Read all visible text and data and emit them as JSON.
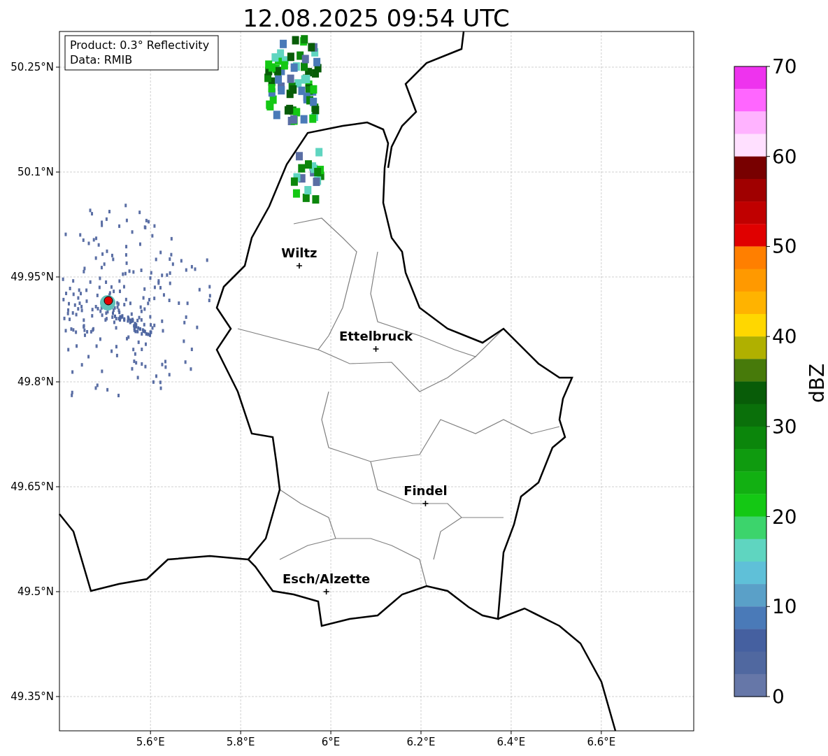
{
  "title": "12.08.2025 09:54 UTC",
  "info_box": [
    "Product: 0.3° Reflectivity",
    "Data: RMIB"
  ],
  "map": {
    "yticks": [
      "50.25°N",
      "50.1°N",
      "49.95°N",
      "49.8°N",
      "49.65°N",
      "49.5°N",
      "49.35°N"
    ],
    "xticks": [
      "5.6°E",
      "5.8°E",
      "6°E",
      "6.2°E",
      "6.4°E",
      "6.6°E"
    ],
    "cities": [
      {
        "name": "Wiltz"
      },
      {
        "name": "Ettelbruck"
      },
      {
        "name": "Findel"
      },
      {
        "name": "Esch/Alzette"
      }
    ]
  },
  "colorbar": {
    "label": "dBZ",
    "ticks": [
      "70",
      "60",
      "50",
      "40",
      "30",
      "20",
      "10",
      "0"
    ],
    "bins": [
      {
        "color": "#ee33ee"
      },
      {
        "color": "#ff66ff"
      },
      {
        "color": "#ffb3ff"
      },
      {
        "color": "#ffe0ff"
      },
      {
        "color": "#780000"
      },
      {
        "color": "#a00000"
      },
      {
        "color": "#c00000"
      },
      {
        "color": "#e00000"
      },
      {
        "color": "#ff7f00"
      },
      {
        "color": "#ff9900"
      },
      {
        "color": "#ffb300"
      },
      {
        "color": "#ffd700"
      },
      {
        "color": "#b0b000"
      },
      {
        "color": "#477a0a"
      },
      {
        "color": "#085c08"
      },
      {
        "color": "#0a700a"
      },
      {
        "color": "#0b860b"
      },
      {
        "color": "#0f9b0f"
      },
      {
        "color": "#12b012"
      },
      {
        "color": "#14c814"
      },
      {
        "color": "#3cd46c"
      },
      {
        "color": "#5fd5c0"
      },
      {
        "color": "#5fc0d8"
      },
      {
        "color": "#5aa0c8"
      },
      {
        "color": "#4a7ab8"
      },
      {
        "color": "#4560a0"
      },
      {
        "color": "#5068a0"
      },
      {
        "color": "#6677a8"
      }
    ]
  }
}
